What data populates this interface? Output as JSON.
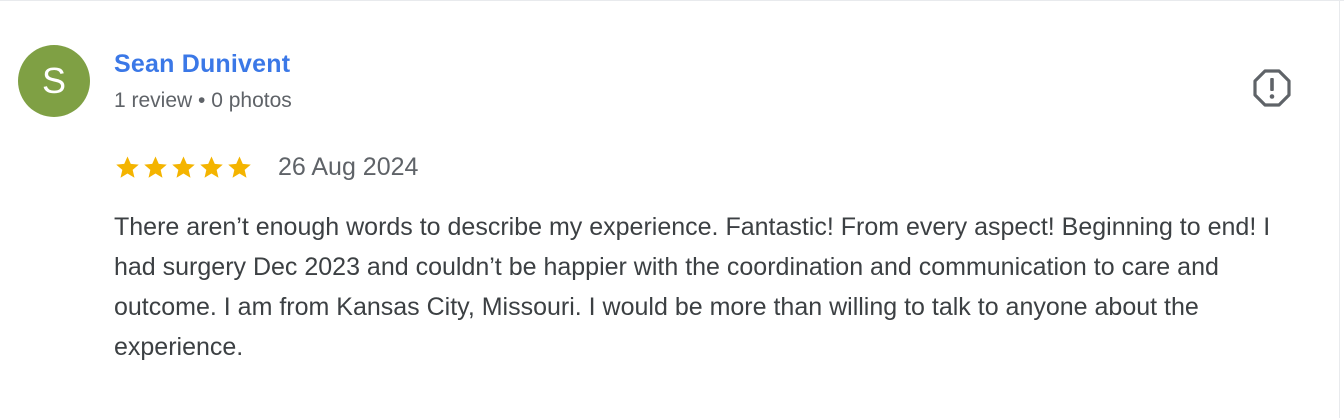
{
  "reviewer": {
    "initial": "S",
    "name": "Sean Dunivent",
    "meta": "1 review • 0 photos",
    "avatar_color": "#7fa044"
  },
  "review": {
    "rating": 5,
    "max_rating": 5,
    "date": "26 Aug 2024",
    "text": "There aren’t enough words to describe my experience. Fantastic! From every aspect! Beginning to end! I had surgery Dec 2023 and couldn’t be happier with the coordination and communication to care and outcome. I am from Kansas City, Missouri. I would be more than willing to talk to anyone about the experience."
  },
  "icons": {
    "star": "star-icon",
    "flag": "report-flag-icon"
  },
  "colors": {
    "name_link": "#3b78e7",
    "star": "#f4b400",
    "meta_text": "#5f6368",
    "body_text": "#3c4043"
  }
}
